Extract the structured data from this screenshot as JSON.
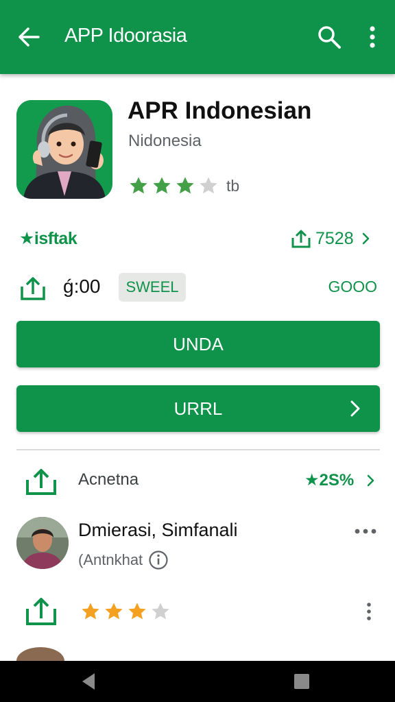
{
  "toolbar": {
    "title": "APP Idoorasia",
    "icons": [
      "arrow-back-icon",
      "search-icon",
      "more-vert-icon"
    ]
  },
  "app": {
    "name": "APR Indonesian",
    "developer": "Nidonesia",
    "rating_stars": 3,
    "rating_max": 5,
    "rating_count": "tb"
  },
  "stats": {
    "label": "★isftak",
    "downloads": "7528"
  },
  "price_row": {
    "price": "ǵ:00",
    "chip": "SWEEL",
    "value": "GOOO"
  },
  "buttons": {
    "primary": "UNDA",
    "secondary": "URRL"
  },
  "list": {
    "row1": {
      "label": "Acnetna",
      "percent": "★2S%"
    },
    "reviewer": {
      "name": "Dmierasi, Simfanali",
      "handle": "(Antnkhat"
    },
    "row3": {
      "stars": 3,
      "max": 4
    }
  },
  "colors": {
    "brand_green": "#0f9249",
    "star_green": "#43a047",
    "star_orange": "#f4a021",
    "star_empty": "#d0d0d0"
  }
}
